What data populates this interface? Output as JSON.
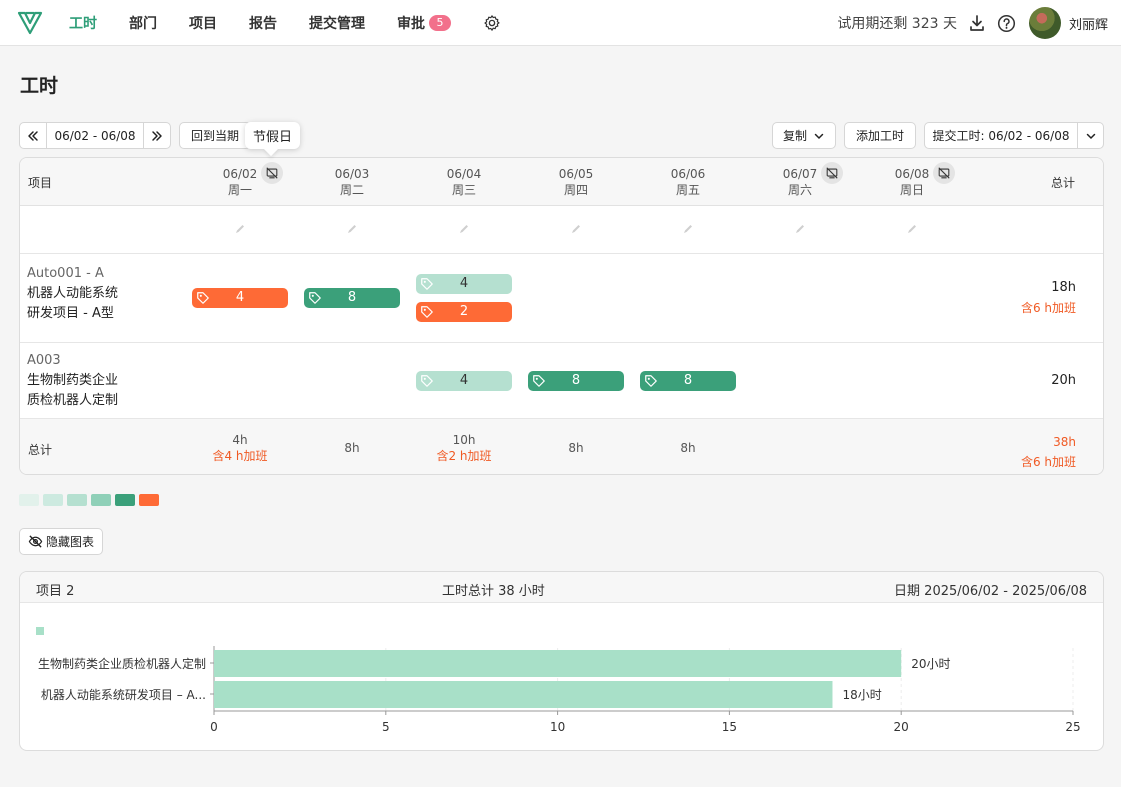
{
  "nav": {
    "items": [
      "工时",
      "部门",
      "项目",
      "报告",
      "提交管理",
      "审批"
    ],
    "approval_badge": "5",
    "trial_text": "试用期还剩 323 天",
    "user_name": "刘丽辉",
    "accent_color": "#2e9e78"
  },
  "page_title": "工时",
  "toolbar": {
    "prev_icon": "double-chevron-left-icon",
    "date_range": "06/02 - 06/08",
    "next_icon": "double-chevron-right-icon",
    "back_to_current": "回到当期",
    "tooltip": "节假日",
    "copy": "复制",
    "add_time": "添加工时",
    "submit": "提交工时: 06/02 - 06/08"
  },
  "table": {
    "project_header": "项目",
    "total_header": "总计",
    "days": [
      {
        "date": "06/02",
        "weekday": "周一",
        "holiday_toggle": true
      },
      {
        "date": "06/03",
        "weekday": "周二",
        "holiday_toggle": false
      },
      {
        "date": "06/04",
        "weekday": "周三",
        "holiday_toggle": false
      },
      {
        "date": "06/05",
        "weekday": "周四",
        "holiday_toggle": false
      },
      {
        "date": "06/06",
        "weekday": "周五",
        "holiday_toggle": false
      },
      {
        "date": "06/07",
        "weekday": "周六",
        "holiday_toggle": true
      },
      {
        "date": "06/08",
        "weekday": "周日",
        "holiday_toggle": true
      }
    ],
    "rows": [
      {
        "code": "Auto001 - A",
        "name_line1": "机器人动能系统",
        "name_line2": "研发项目 - A型",
        "total": "18h",
        "overtime": "含6 h加班",
        "entries": [
          {
            "day": 0,
            "value": "4",
            "kind": "orange"
          },
          {
            "day": 1,
            "value": "8",
            "kind": "green"
          },
          {
            "day": 2,
            "value": "4",
            "kind": "light"
          },
          {
            "day": 2,
            "value": "2",
            "kind": "orange"
          }
        ]
      },
      {
        "code": "A003",
        "name_line1": "生物制药类企业",
        "name_line2": "质检机器人定制",
        "total": "20h",
        "overtime": "",
        "entries": [
          {
            "day": 2,
            "value": "4",
            "kind": "light"
          },
          {
            "day": 3,
            "value": "8",
            "kind": "green"
          },
          {
            "day": 4,
            "value": "8",
            "kind": "green"
          }
        ]
      }
    ],
    "footer": {
      "label": "总计",
      "days": [
        {
          "hours": "4h",
          "overtime": "含4 h加班"
        },
        {
          "hours": "8h",
          "overtime": ""
        },
        {
          "hours": "10h",
          "overtime": "含2 h加班"
        },
        {
          "hours": "8h",
          "overtime": ""
        },
        {
          "hours": "8h",
          "overtime": ""
        },
        {
          "hours": "",
          "overtime": ""
        },
        {
          "hours": "",
          "overtime": ""
        }
      ],
      "total": "38h",
      "total_overtime": "含6 h加班"
    }
  },
  "legend_colors": [
    "#e2f1eb",
    "#cdeae0",
    "#b5e0d0",
    "#8fd0b8",
    "#3ba07a",
    "#fe6a36"
  ],
  "hide_chart_button": "隐藏图表",
  "chart_card": {
    "project_count": "项目 2",
    "total_hours": "工时总计 38 小时",
    "date_range": "日期 2025/06/02 - 2025/06/08"
  },
  "chart_data": {
    "type": "bar",
    "orientation": "horizontal",
    "categories": [
      "生物制药类企业质检机器人定制",
      "机器人动能系统研发项目 – A..."
    ],
    "values": [
      20,
      18
    ],
    "data_labels": [
      "20小时",
      "18小时"
    ],
    "xlim": [
      0,
      25
    ],
    "xticks": [
      0,
      5,
      10,
      15,
      20,
      25
    ],
    "bar_color": "#a8e0c8",
    "legend": "top-left swatch"
  }
}
